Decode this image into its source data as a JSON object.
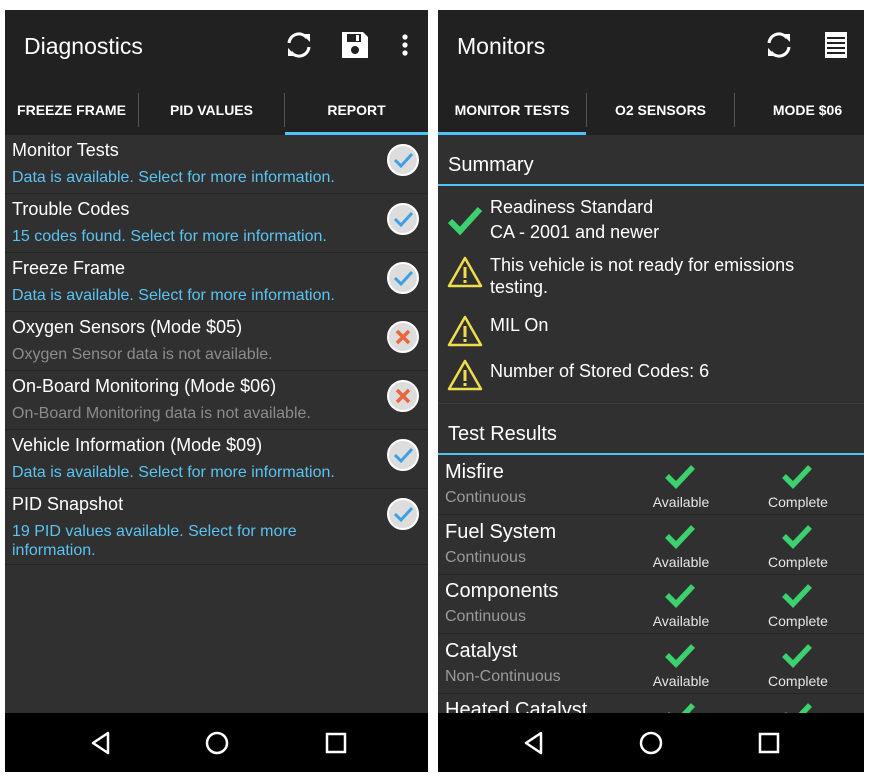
{
  "diagnostics": {
    "title": "Diagnostics",
    "actions": [
      "refresh-icon",
      "save-icon",
      "overflow-menu-icon"
    ],
    "tabs": [
      {
        "label": "FREEZE FRAME",
        "selected": false
      },
      {
        "label": "PID VALUES",
        "selected": false
      },
      {
        "label": "REPORT",
        "selected": true
      }
    ],
    "items": [
      {
        "title": "Monitor Tests",
        "subtitle": "Data is available. Select for more information.",
        "available": true
      },
      {
        "title": "Trouble Codes",
        "subtitle": "15 codes found. Select for more information.",
        "available": true
      },
      {
        "title": "Freeze Frame",
        "subtitle": "Data is available. Select for more information.",
        "available": true
      },
      {
        "title": "Oxygen Sensors (Mode $05)",
        "subtitle": "Oxygen Sensor data is not available.",
        "available": false
      },
      {
        "title": "On-Board Monitoring (Mode $06)",
        "subtitle": "On-Board Monitoring data is not available.",
        "available": false
      },
      {
        "title": "Vehicle Information (Mode $09)",
        "subtitle": "Data is available. Select for more information.",
        "available": true
      },
      {
        "title": "PID Snapshot",
        "subtitle": "19 PID values available. Select for more information.",
        "available": true
      }
    ]
  },
  "monitors": {
    "title": "Monitors",
    "actions": [
      "refresh-icon",
      "list-icon"
    ],
    "tabs": [
      {
        "label": "MONITOR TESTS",
        "selected": true
      },
      {
        "label": "O2 SENSORS",
        "selected": false
      },
      {
        "label": "MODE $06",
        "selected": false
      }
    ],
    "summary_header": "Summary",
    "summary": [
      {
        "icon": "check-icon",
        "line1": "Readiness Standard",
        "line2": "CA - 2001 and newer"
      },
      {
        "icon": "warning-icon",
        "line1": "This vehicle is not ready for emissions",
        "line2": "testing."
      },
      {
        "icon": "warning-icon",
        "line1": "MIL On",
        "line2": ""
      },
      {
        "icon": "warning-icon",
        "line1": "Number of Stored Codes: 6",
        "line2": ""
      }
    ],
    "results_header": "Test Results",
    "results": [
      {
        "name": "Misfire",
        "type": "Continuous",
        "availability": "Available",
        "completion": "Complete"
      },
      {
        "name": "Fuel System",
        "type": "Continuous",
        "availability": "Available",
        "completion": "Complete"
      },
      {
        "name": "Components",
        "type": "Continuous",
        "availability": "Available",
        "completion": "Complete"
      },
      {
        "name": "Catalyst",
        "type": "Non-Continuous",
        "availability": "Available",
        "completion": "Complete"
      },
      {
        "name": "Heated Catalyst",
        "type": "",
        "availability": "",
        "completion": ""
      }
    ]
  },
  "navbar": [
    "back-icon",
    "home-icon",
    "recents-icon"
  ],
  "colors": {
    "accent": "#4fc3f7",
    "check_green": "#3bd16f",
    "warning_yellow": "#f0dd4a",
    "error_orange": "#e8673c",
    "link_blue": "#5bc3f2"
  }
}
